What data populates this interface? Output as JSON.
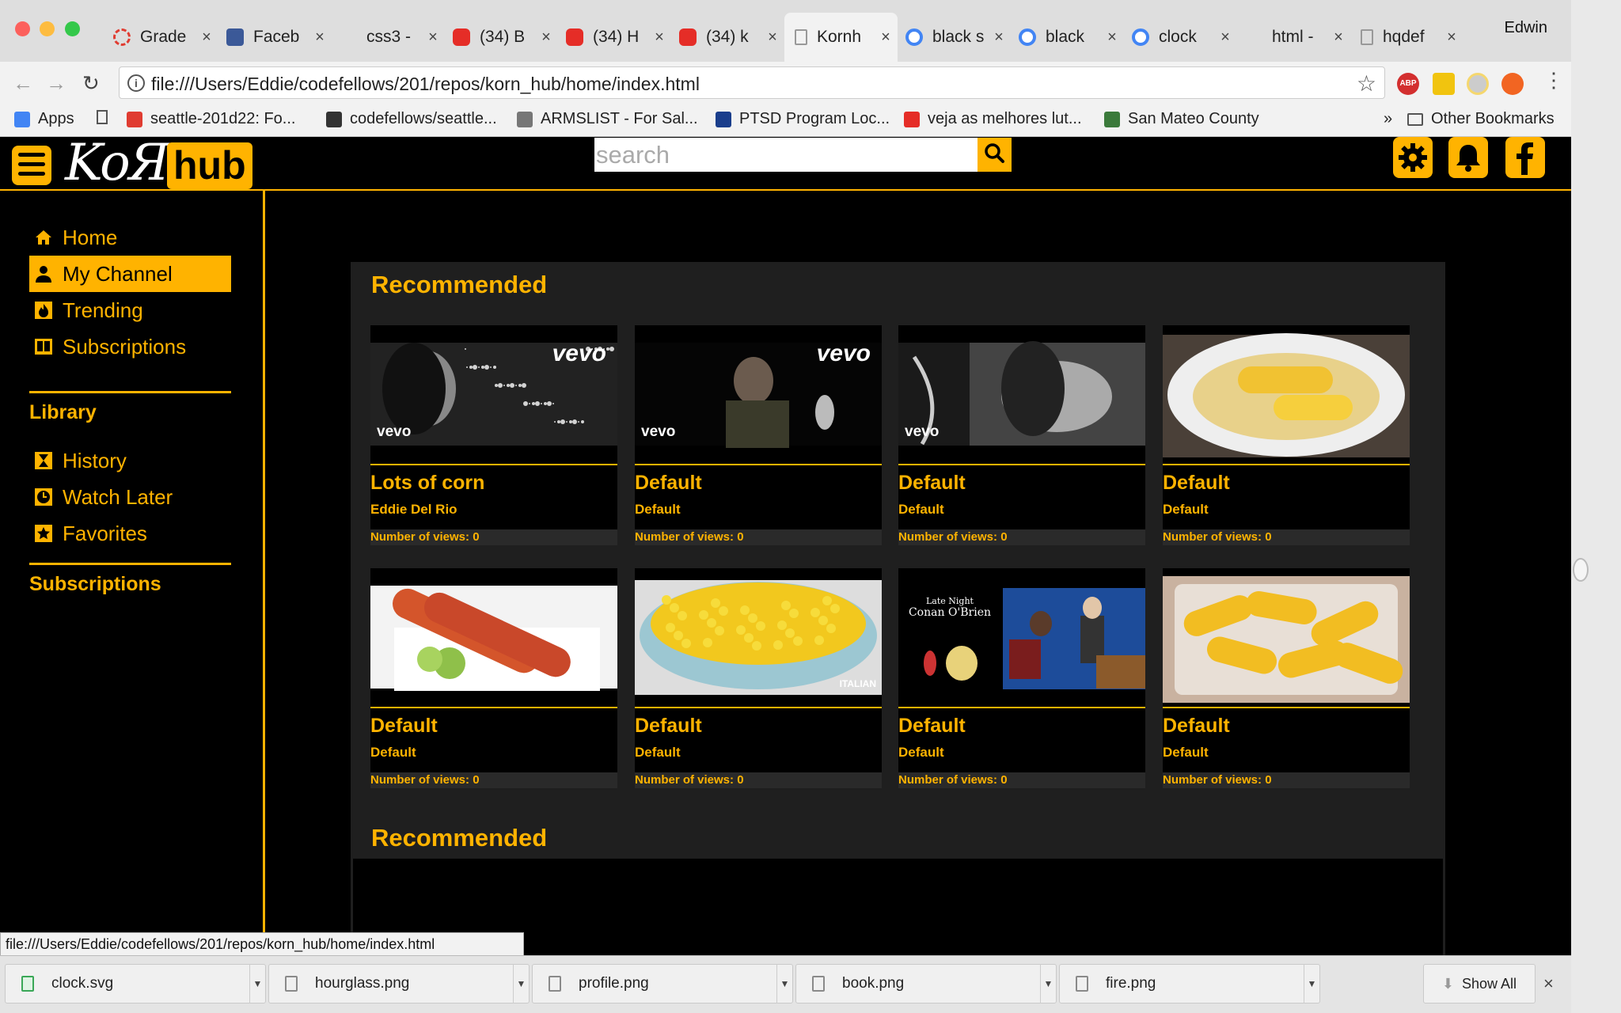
{
  "browser": {
    "tabs": [
      {
        "title": "Grade",
        "fav": "cf"
      },
      {
        "title": "Faceb",
        "fav": "fb"
      },
      {
        "title": "css3 -",
        "fav": "so"
      },
      {
        "title": "(34) B",
        "fav": "yt"
      },
      {
        "title": "(34) H",
        "fav": "yt"
      },
      {
        "title": "(34) k",
        "fav": "yt"
      },
      {
        "title": "Kornh",
        "fav": "doc",
        "active": true
      },
      {
        "title": "black s",
        "fav": "g"
      },
      {
        "title": "black",
        "fav": "g"
      },
      {
        "title": "clock",
        "fav": "g"
      },
      {
        "title": "html -",
        "fav": "so"
      },
      {
        "title": "hqdef",
        "fav": "doc"
      }
    ],
    "tab_close": "×",
    "user": "Edwin",
    "url": "file:///Users/Eddie/codefellows/201/repos/korn_hub/home/index.html",
    "ext_abp": "ABP",
    "bookmarks": [
      "Apps",
      "seattle-201d22: Fo...",
      "codefellows/seattle...",
      "ARMSLIST - For Sal...",
      "PTSD Program Loc...",
      "veja as melhores lut...",
      "San Mateo County"
    ],
    "bookmarks_overflow": "»",
    "other_bookmarks": "Other Bookmarks",
    "status_url": "file:///Users/Eddie/codefellows/201/repos/korn_hub/home/index.html",
    "downloads": [
      "clock.svg",
      "hourglass.png",
      "profile.png",
      "book.png",
      "fire.png"
    ],
    "show_all": "Show All"
  },
  "site": {
    "logo_korn": "KoЯn",
    "logo_hub": "hub",
    "search_placeholder": "search",
    "nav": [
      {
        "label": "Home",
        "icon": "home-icon"
      },
      {
        "label": "My Channel",
        "icon": "profile-icon",
        "selected": true
      },
      {
        "label": "Trending",
        "icon": "fire-icon"
      },
      {
        "label": "Subscriptions",
        "icon": "book-icon"
      }
    ],
    "library_heading": "Library",
    "library": [
      {
        "label": "History",
        "icon": "hourglass-icon"
      },
      {
        "label": "Watch Later",
        "icon": "clock-icon"
      },
      {
        "label": "Favorites",
        "icon": "star-icon"
      }
    ],
    "subscriptions_heading": "Subscriptions",
    "sections": [
      {
        "heading": "Recommended"
      },
      {
        "heading": "Recommended"
      }
    ],
    "videos": [
      {
        "title": "Lots of corn",
        "author": "Eddie Del Rio",
        "views": "Number of views: 0",
        "thumb": "music video singer"
      },
      {
        "title": "Default",
        "author": "Default",
        "views": "Number of views: 0",
        "thumb": "music video rapper"
      },
      {
        "title": "Default",
        "author": "Default",
        "views": "Number of views: 0",
        "thumb": "music video closeup"
      },
      {
        "title": "Default",
        "author": "Default",
        "views": "Number of views: 0",
        "thumb": "corn on plate"
      },
      {
        "title": "Default",
        "author": "Default",
        "views": "Number of views: 0",
        "thumb": "elote corn"
      },
      {
        "title": "Default",
        "author": "Default",
        "views": "Number of views: 0",
        "thumb": "corn casserole"
      },
      {
        "title": "Default",
        "author": "Default",
        "views": "Number of views: 0",
        "thumb": "late night show"
      },
      {
        "title": "Default",
        "author": "Default",
        "views": "Number of views: 0",
        "thumb": "corn in dish"
      }
    ],
    "thumb_labels": {
      "vevo": "vevo",
      "italian": "ITALIAN",
      "late_night": "Late Night",
      "conan": "Conan O'Brien"
    },
    "colors": {
      "accent": "#ffb300",
      "page_bg": "#000000",
      "section_bg": "#1f1f1f"
    }
  }
}
